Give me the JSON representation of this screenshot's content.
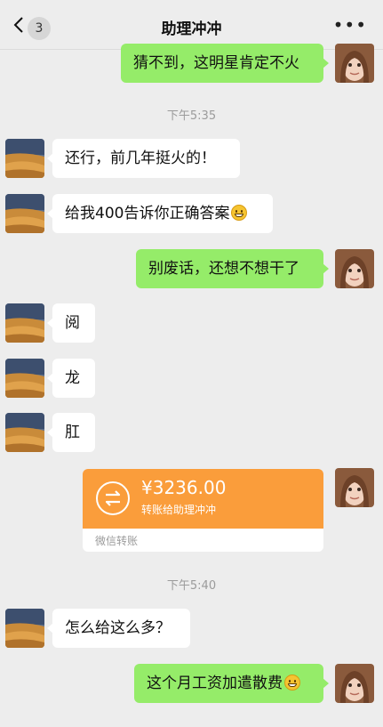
{
  "header": {
    "back_count": "3",
    "title": "助理冲冲"
  },
  "messages": [
    {
      "side": "me",
      "text": "猜不到，这明星肯定不火"
    },
    {
      "time": "下午5:35"
    },
    {
      "side": "other",
      "text": "还行，前几年挺火的！"
    },
    {
      "side": "other",
      "text": "给我400告诉你正确答案",
      "emoji": "grin-emoji-icon"
    },
    {
      "side": "me",
      "text": "别废话，还想不想干了"
    },
    {
      "side": "other",
      "text": "阅"
    },
    {
      "side": "other",
      "text": "龙"
    },
    {
      "side": "other",
      "text": "肛"
    },
    {
      "side": "me",
      "transfer": {
        "amount": "¥3236.00",
        "note": "转账给助理冲冲",
        "footer": "微信转账"
      }
    },
    {
      "time": "下午5:40"
    },
    {
      "side": "other",
      "text": "怎么给这么多？"
    },
    {
      "side": "me",
      "text": "这个月工资加遣散费",
      "emoji": "cheeky-emoji-icon"
    }
  ],
  "colors": {
    "background": "#ededed",
    "my_bubble": "#95ec69",
    "other_bubble": "#ffffff",
    "transfer": "#fa9d3b"
  }
}
